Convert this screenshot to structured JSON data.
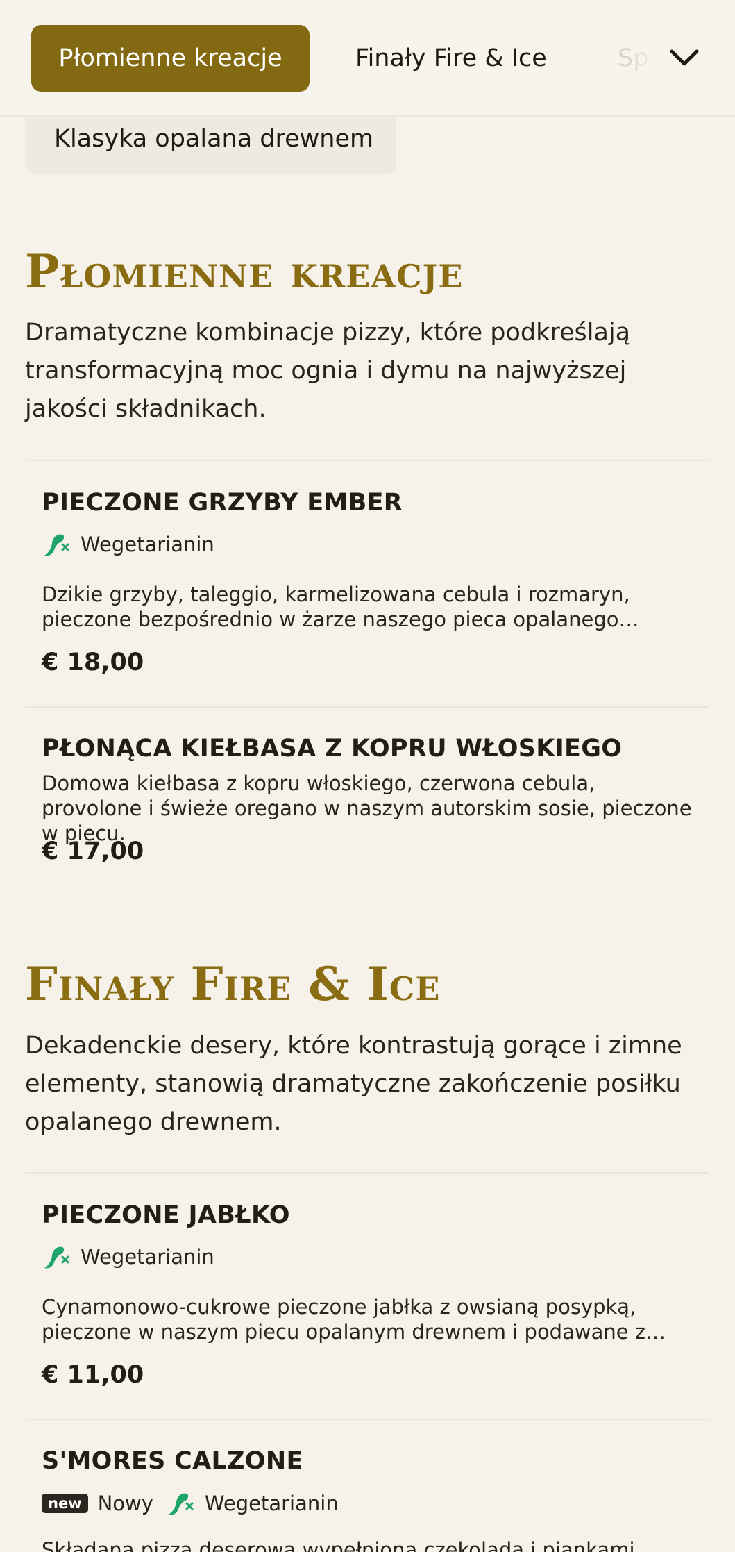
{
  "nav": {
    "tabs": [
      "Płomienne kreacje",
      "Finały Fire & Ice",
      "Sp"
    ],
    "subtab": "Klasyka opalana drewnem"
  },
  "sections": [
    {
      "title": "Płomienne kreacje",
      "description": "Dramatyczne kombinacje pizzy, które podkreślają transformacyjną moc ognia i dymu na najwyższej jakości składnikach.",
      "items": [
        {
          "name": "PIECZONE GRZYBY EMBER",
          "tags": [
            "Wegetarianin"
          ],
          "description": "Dzikie grzyby, taleggio, karmelizowana cebula i rozmaryn, pieczone bezpośrednio w żarze naszego pieca opalanego drewnem dla wyjątkowego aromatu.",
          "price": "€ 18,00"
        },
        {
          "name": "PŁONĄCA KIEŁBASA Z KOPRU WŁOSKIEGO",
          "tags": [],
          "description": "Domowa kiełbasa z kopru włoskiego, czerwona cebula, provolone i świeże oregano w naszym autorskim sosie, pieczone w piecu.",
          "price": "€ 17,00"
        }
      ]
    },
    {
      "title": "Finały Fire & Ice",
      "description": "Dekadenckie desery, które kontrastują gorące i zimne elementy, stanowią dramatyczne zakończenie posiłku opalanego drewnem.",
      "items": [
        {
          "name": "PIECZONE JABŁKO",
          "tags": [
            "Wegetarianin"
          ],
          "description": "Cynamonowo-cukrowe pieczone jabłka z owsianą posypką, pieczone w naszym piecu opalanym drewnem i podawane z gałką lodów waniliowych.",
          "price": "€ 11,00"
        },
        {
          "name": "S'MORES CALZONE",
          "badge": "new",
          "badge_label": "Nowy",
          "tags": [
            "Wegetarianin"
          ],
          "description": "Składana pizza deserowa wypełniona czekoladą i piankami",
          "price": ""
        }
      ]
    }
  ],
  "colors": {
    "accent": "#836a12",
    "title": "#8a6c12",
    "background": "#f6f2ea",
    "veg_icon": "#1fa56a"
  }
}
